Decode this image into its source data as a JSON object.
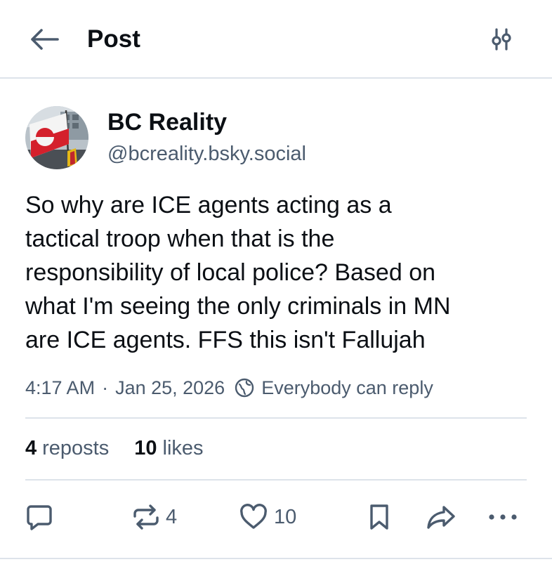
{
  "header": {
    "title": "Post",
    "back_icon": "arrow-left-icon",
    "filter_icon": "sliders-icon"
  },
  "author": {
    "display_name": "BC Reality",
    "handle": "@bcreality.bsky.social",
    "avatar": "greenland-flag-avatar"
  },
  "post": {
    "lines": [
      "So why are ICE agents acting as a",
      "tactical troop when that is the",
      "responsibility of local police? Based on",
      "what I'm seeing the only criminals in MN",
      "are ICE agents. FFS this isn't Fallujah"
    ],
    "time": "4:17 AM",
    "separator": "·",
    "date": "Jan 25, 2026",
    "reply_setting": "Everybody can reply"
  },
  "stats": {
    "reposts_count": "4",
    "reposts_label": "reposts",
    "likes_count": "10",
    "likes_label": "likes"
  },
  "actions": {
    "repost_count": "4",
    "like_count": "10"
  },
  "colors": {
    "text": "#0b0f14",
    "muted": "#4b5b6e",
    "divider": "#dde3ea",
    "icon": "#4b5b6e"
  }
}
